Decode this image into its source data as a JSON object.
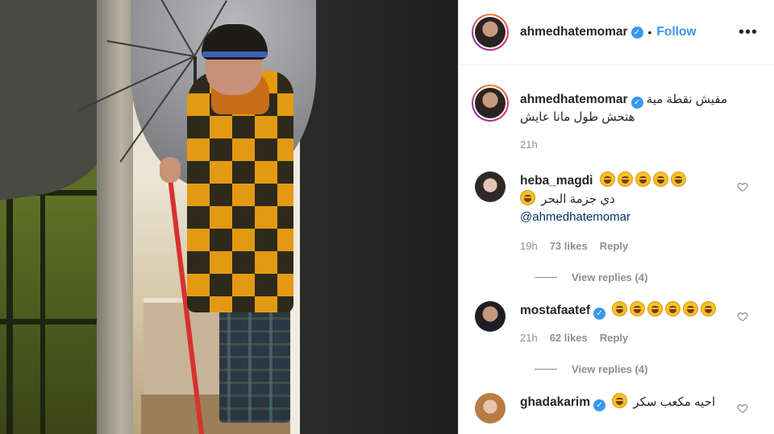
{
  "post": {
    "username": "ahmedhatemomar",
    "follow_label": "Follow",
    "dot": "•",
    "more_icon": "more-horizontal-icon",
    "verified_icon": "verified-badge-icon"
  },
  "caption": {
    "username": "ahmedhatemomar",
    "line1": "مفيش نقطة مية",
    "line2": "هتحش طول مانا عايش",
    "time": "21h"
  },
  "comments": [
    {
      "username": "heba_magdi",
      "verified": false,
      "text": "دي جزمة البحر",
      "mention": "@ahmedhatemomar",
      "emoji_count_line1": 5,
      "emoji_count_line2": 1,
      "time": "19h",
      "likes": "73 likes",
      "reply": "Reply",
      "view_replies": "View replies (4)"
    },
    {
      "username": "mostafaatef",
      "verified": true,
      "emoji_count_line1": 6,
      "time": "21h",
      "likes": "62 likes",
      "reply": "Reply",
      "view_replies": "View replies (4)"
    },
    {
      "username": "ghadakarim",
      "verified": true,
      "text": "احيه مكعب سكر"
    }
  ],
  "colors": {
    "accent_blue": "#3897f0",
    "meta_gray": "#8e8e8e",
    "text": "#262626"
  }
}
